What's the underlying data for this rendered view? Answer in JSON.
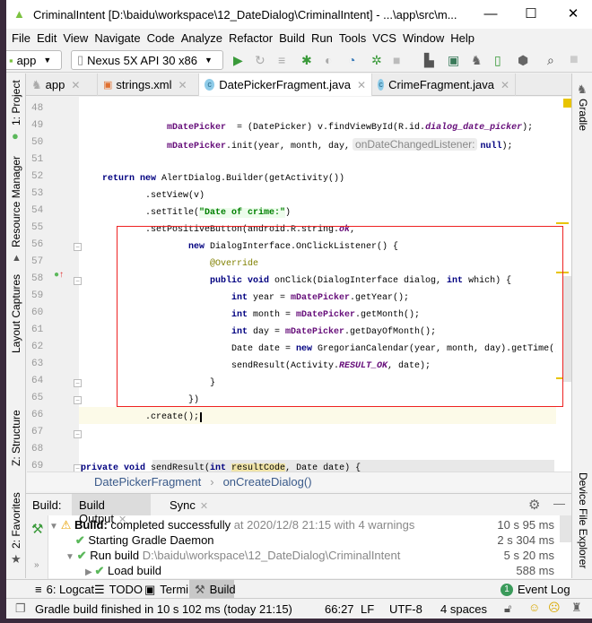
{
  "window": {
    "title": "CriminalIntent [D:\\baidu\\workspace\\12_DateDialog\\CriminalIntent] - ...\\app\\src\\m...",
    "minimize": "—",
    "maximize": "☐",
    "close": "✕"
  },
  "menu": [
    "File",
    "Edit",
    "View",
    "Navigate",
    "Code",
    "Analyze",
    "Refactor",
    "Build",
    "Run",
    "Tools",
    "VCS",
    "Window",
    "Help"
  ],
  "toolbar": {
    "module": "app",
    "device": "Nexus 5X API 30 x86"
  },
  "tabs": [
    {
      "label": "app"
    },
    {
      "label": "strings.xml"
    },
    {
      "label": "DatePickerFragment.java",
      "selected": true
    },
    {
      "label": "CrimeFragment.java"
    }
  ],
  "left_tools": [
    "1: Project",
    "Resource Manager",
    "Layout Captures",
    "Z: Structure",
    "2: Favorites"
  ],
  "right_tools": [
    "Gradle",
    "Device File Explorer"
  ],
  "editor": {
    "first_line": 48,
    "line_numbers": [
      "48",
      "49",
      "50",
      "51",
      "52",
      "53",
      "54",
      "55",
      "56",
      "57",
      "58",
      "59",
      "60",
      "61",
      "62",
      "63",
      "64",
      "65",
      "66",
      "67",
      "68",
      "69"
    ],
    "current_line": "66",
    "lines": [
      {
        "indent": 0,
        "tokens": []
      },
      {
        "indent": 20,
        "tokens": [
          [
            "fd",
            "mDatePicker"
          ],
          [
            "",
            "  = (DatePicker) v.findViewById(R.id."
          ],
          [
            "st",
            "dialog_date_picker"
          ],
          [
            "",
            ");"
          ]
        ]
      },
      {
        "indent": 20,
        "tokens": [
          [
            "fd",
            "mDatePicker"
          ],
          [
            "",
            ".init(year, month, day,"
          ],
          [
            "hint",
            "onDateChangedListener:"
          ],
          [
            "kw",
            "null"
          ],
          [
            "",
            ");"
          ]
        ]
      },
      {
        "indent": 0,
        "tokens": []
      },
      {
        "indent": 8,
        "tokens": [
          [
            "kw",
            "return new "
          ],
          [
            "",
            "AlertDialog.Builder(getActivity())"
          ]
        ]
      },
      {
        "indent": 16,
        "tokens": [
          [
            "",
            ".setView(v)"
          ]
        ]
      },
      {
        "indent": 16,
        "tokens": [
          [
            "",
            ".setTitle("
          ],
          [
            "str",
            "\"Date of crime:\""
          ],
          [
            "",
            ")"
          ]
        ]
      },
      {
        "indent": 16,
        "tokens": [
          [
            "",
            ".setPositiveButton(android.R.string."
          ],
          [
            "st",
            "ok"
          ],
          [
            "",
            ","
          ]
        ]
      },
      {
        "indent": 24,
        "tokens": [
          [
            "kw",
            "new "
          ],
          [
            "",
            "DialogInterface.OnClickListener() {"
          ]
        ]
      },
      {
        "indent": 28,
        "tokens": [
          [
            "an",
            "@Override"
          ]
        ]
      },
      {
        "indent": 28,
        "tokens": [
          [
            "kw",
            "public void "
          ],
          [
            "",
            "onClick(DialogInterface dialog, "
          ],
          [
            "kw",
            "int "
          ],
          [
            "",
            "which) {"
          ]
        ]
      },
      {
        "indent": 32,
        "tokens": [
          [
            "kw",
            "int "
          ],
          [
            "",
            "year = "
          ],
          [
            "fd",
            "mDatePicker"
          ],
          [
            "",
            ".getYear();"
          ]
        ]
      },
      {
        "indent": 32,
        "tokens": [
          [
            "kw",
            "int "
          ],
          [
            "",
            "month = "
          ],
          [
            "fd",
            "mDatePicker"
          ],
          [
            "",
            ".getMonth();"
          ]
        ]
      },
      {
        "indent": 32,
        "tokens": [
          [
            "kw",
            "int "
          ],
          [
            "",
            "day = "
          ],
          [
            "fd",
            "mDatePicker"
          ],
          [
            "",
            ".getDayOfMonth();"
          ]
        ]
      },
      {
        "indent": 32,
        "tokens": [
          [
            "",
            "Date date = "
          ],
          [
            "kw",
            "new "
          ],
          [
            "",
            "GregorianCalendar(year, month, day).getTime();"
          ]
        ]
      },
      {
        "indent": 32,
        "tokens": [
          [
            "",
            "sendResult(Activity."
          ],
          [
            "st",
            "RESULT_OK"
          ],
          [
            "",
            ", date);"
          ]
        ]
      },
      {
        "indent": 28,
        "tokens": [
          [
            "",
            "}"
          ]
        ]
      },
      {
        "indent": 24,
        "tokens": [
          [
            "",
            "})"
          ]
        ]
      },
      {
        "indent": 16,
        "tokens": [
          [
            "",
            ".create();"
          ]
        ]
      },
      {
        "indent": 0,
        "tokens": []
      },
      {
        "indent": 0,
        "tokens": []
      },
      {
        "indent": 4,
        "tokens": [
          [
            "kw",
            "private void "
          ],
          [
            "",
            "sendResult("
          ],
          [
            "kw",
            "int "
          ],
          [
            "hl",
            "resultCode"
          ],
          [
            "",
            ", Date date) {"
          ]
        ]
      }
    ]
  },
  "breadcrumb": [
    "DatePickerFragment",
    "onCreateDialog()"
  ],
  "build": {
    "label": "Build:",
    "tabs": [
      "Build Output",
      "Sync"
    ],
    "rows": [
      {
        "bold": "Build:",
        "text": " completed successfully",
        "extra": " at 2020/12/8 21:15  with 4 warnings",
        "time": "10 s 95 ms",
        "icon": "warning-icon"
      },
      {
        "text": "Starting Gradle Daemon",
        "time": "2 s 304 ms",
        "icon": "check-icon"
      },
      {
        "text": "Run build",
        "extra": " D:\\baidu\\workspace\\12_DateDialog\\CriminalIntent",
        "time": "5 s 20 ms",
        "icon": "check-icon"
      },
      {
        "text": "Load build",
        "time": "588 ms",
        "icon": "check-icon"
      }
    ]
  },
  "bottom_tabs": [
    "6: Logcat",
    "TODO",
    "Terminal",
    "Build"
  ],
  "event_log": {
    "label": "Event Log",
    "count": "1"
  },
  "status": {
    "message": "Gradle build finished in 10 s 102 ms (today 21:15)",
    "position": "66:27",
    "line_sep": "LF",
    "encoding": "UTF-8",
    "indent": "4 spaces"
  },
  "colors": {
    "keyword": "#000080",
    "field": "#660e7a",
    "string": "#008000",
    "annotation": "#808000",
    "highlight_box": "#ee2222",
    "run": "#3a9a3a"
  }
}
